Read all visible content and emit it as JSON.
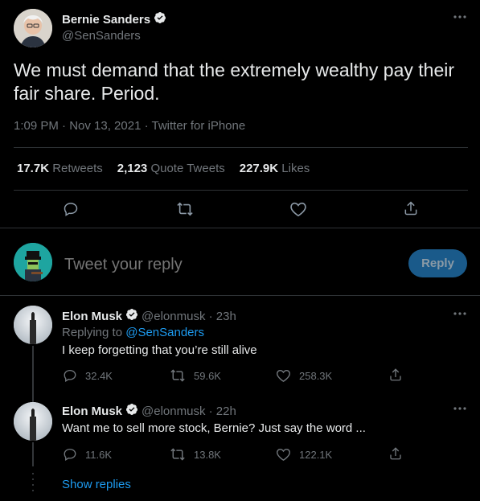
{
  "main_tweet": {
    "author_name": "Bernie Sanders",
    "author_handle": "@SenSanders",
    "text": "We must demand that the extremely wealthy pay their fair share. Period.",
    "meta": "1:09 PM · Nov 13, 2021 · Twitter for iPhone",
    "stats": {
      "retweets_count": "17.7K",
      "retweets_label": "Retweets",
      "quotes_count": "2,123",
      "quotes_label": "Quote Tweets",
      "likes_count": "227.9K",
      "likes_label": "Likes"
    }
  },
  "reply_box": {
    "placeholder": "Tweet your reply",
    "button_label": "Reply"
  },
  "replies": [
    {
      "author_name": "Elon Musk",
      "handle_time": "@elonmusk · 23h",
      "replying_prefix": "Replying to",
      "replying_to": "@SenSanders",
      "text": "I keep forgetting that you’re still alive",
      "replies": "32.4K",
      "retweets": "59.6K",
      "likes": "258.3K"
    },
    {
      "author_name": "Elon Musk",
      "handle_time": "@elonmusk · 22h",
      "text": "Want me to sell more stock, Bernie? Just say the word ...",
      "replies": "11.6K",
      "retweets": "13.8K",
      "likes": "122.1K"
    }
  ],
  "show_replies": "Show replies",
  "colors": {
    "background": "#000000",
    "text": "#e7e9ea",
    "secondary": "#71767b",
    "accent": "#1d9bf0",
    "reply_button": "#1a5a8a"
  }
}
